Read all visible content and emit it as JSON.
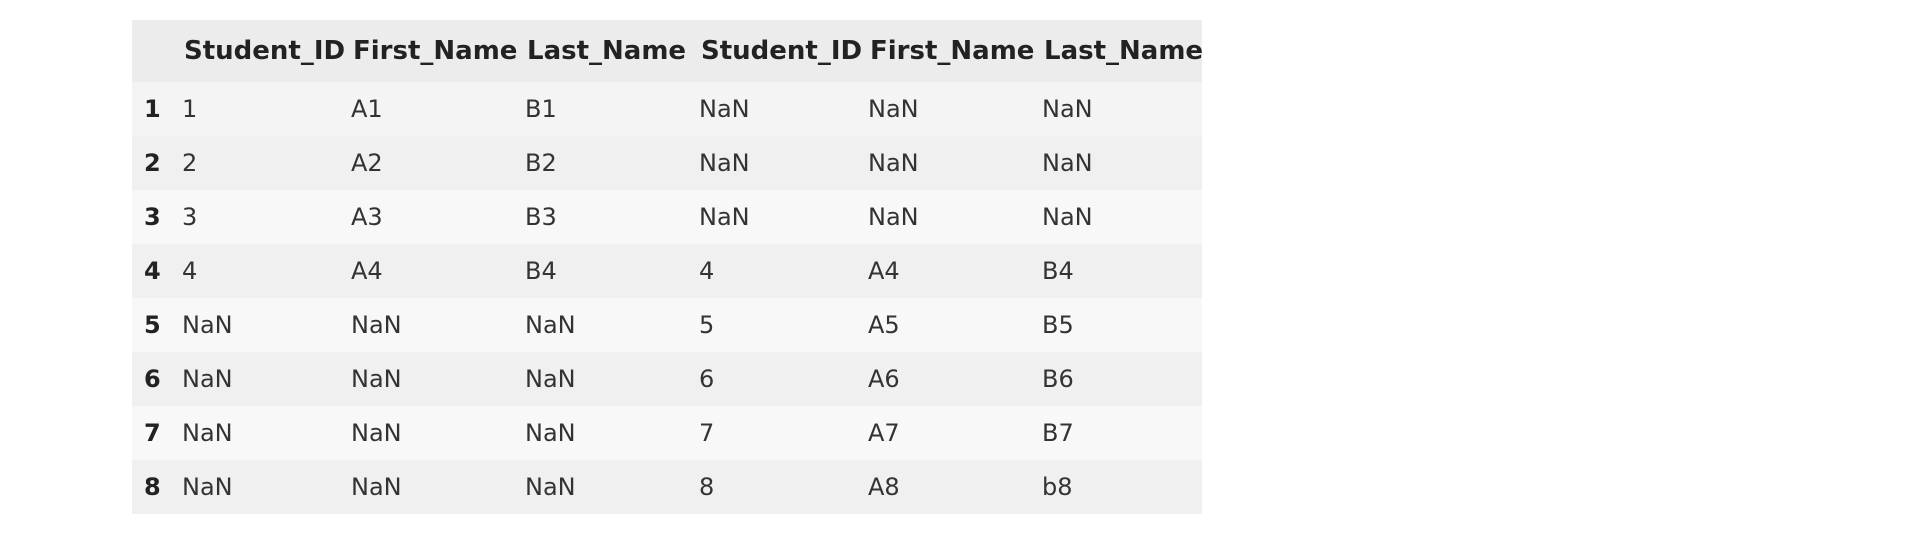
{
  "table": {
    "columns": [
      "",
      "Student_ID",
      "First_Name",
      "Last_Name",
      "Student_ID",
      "First_Name",
      "Last_Name"
    ],
    "rows": [
      [
        "1",
        "1",
        "A1",
        "B1",
        "NaN",
        "NaN",
        "NaN"
      ],
      [
        "2",
        "2",
        "A2",
        "B2",
        "NaN",
        "NaN",
        "NaN"
      ],
      [
        "3",
        "3",
        "A3",
        "B3",
        "NaN",
        "NaN",
        "NaN"
      ],
      [
        "4",
        "4",
        "A4",
        "B4",
        "4",
        "A4",
        "B4"
      ],
      [
        "5",
        "NaN",
        "NaN",
        "NaN",
        "5",
        "A5",
        "B5"
      ],
      [
        "6",
        "NaN",
        "NaN",
        "NaN",
        "6",
        "A6",
        "B6"
      ],
      [
        "7",
        "NaN",
        "NaN",
        "NaN",
        "7",
        "A7",
        "B7"
      ],
      [
        "8",
        "NaN",
        "NaN",
        "NaN",
        "8",
        "A8",
        "b8"
      ]
    ]
  }
}
